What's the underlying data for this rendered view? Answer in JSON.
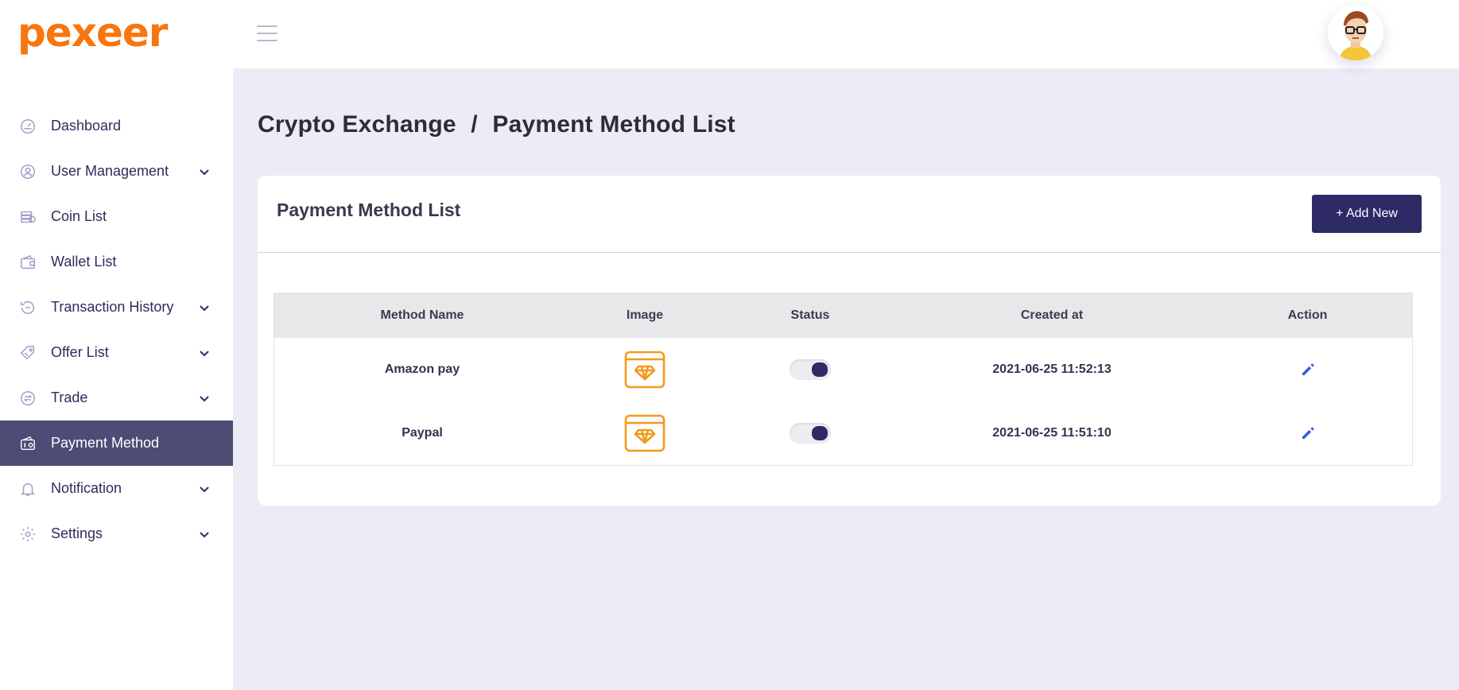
{
  "brand": {
    "name": "pexeer",
    "accent": "#f7760d"
  },
  "sidebar": {
    "items": [
      {
        "label": "Dashboard",
        "icon": "gauge-icon",
        "has_submenu": false,
        "active": false
      },
      {
        "label": "User Management",
        "icon": "user-circle-icon",
        "has_submenu": true,
        "active": false
      },
      {
        "label": "Coin List",
        "icon": "coins-icon",
        "has_submenu": false,
        "active": false
      },
      {
        "label": "Wallet List",
        "icon": "wallet-icon",
        "has_submenu": false,
        "active": false
      },
      {
        "label": "Transaction History",
        "icon": "payment-icon",
        "has_submenu": true,
        "active": false
      },
      {
        "label": "Offer List",
        "icon": "tag-icon",
        "has_submenu": true,
        "active": false
      },
      {
        "label": "Trade",
        "icon": "exchange-icon",
        "has_submenu": true,
        "active": false
      },
      {
        "label": "Payment Method",
        "icon": "wallet-money-icon",
        "has_submenu": false,
        "active": true
      },
      {
        "label": "Notification",
        "icon": "bell-icon",
        "has_submenu": true,
        "active": false
      },
      {
        "label": "Settings",
        "icon": "gear-icon",
        "has_submenu": true,
        "active": false
      }
    ]
  },
  "breadcrumb": {
    "parent": "Crypto Exchange",
    "separator": "/",
    "current": "Payment Method List"
  },
  "card": {
    "title": "Payment Method List",
    "add_button_label": "+ Add New"
  },
  "table": {
    "columns": [
      "Method Name",
      "Image",
      "Status",
      "Created at",
      "Action"
    ],
    "rows": [
      {
        "method_name": "Amazon pay",
        "image_icon": "diamond-browser-icon",
        "status_on": true,
        "created_at": "2021-06-25 11:52:13"
      },
      {
        "method_name": "Paypal",
        "image_icon": "diamond-browser-icon",
        "status_on": true,
        "created_at": "2021-06-25 11:51:10"
      }
    ]
  },
  "colors": {
    "sidebar_active_bg": "#4e4b75",
    "primary": "#2d2a66",
    "page_bg": "#ececf7",
    "image_icon": "#f39a1c",
    "edit_icon": "#2f5fe0"
  }
}
